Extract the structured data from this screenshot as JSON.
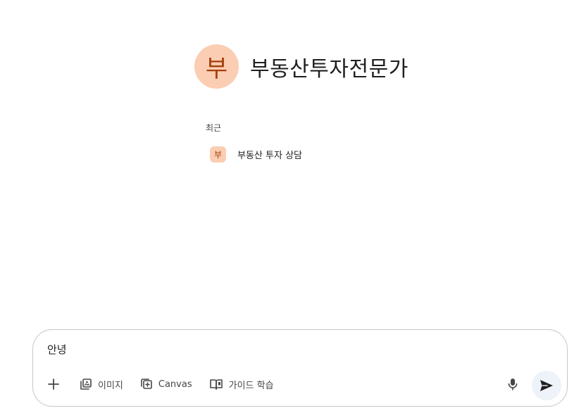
{
  "gem": {
    "avatar_initial": "부",
    "name": "부동산투자전문가"
  },
  "recent": {
    "label": "최근",
    "items": [
      {
        "initial": "부",
        "title": "부동산 투자 상담"
      }
    ]
  },
  "composer": {
    "input_value": "안녕",
    "tools": {
      "image_label": "이미지",
      "canvas_label": "Canvas",
      "guided_learning_label": "가이드 학습"
    },
    "icons": [
      "plus-icon",
      "image-icon",
      "canvas-icon",
      "book-icon",
      "mic-icon",
      "send-icon"
    ]
  },
  "colors": {
    "avatar_bg": "#fbcdb2",
    "avatar_fg": "#a4400b",
    "send_bg": "#eef2f9",
    "border": "#c4c7c5"
  }
}
